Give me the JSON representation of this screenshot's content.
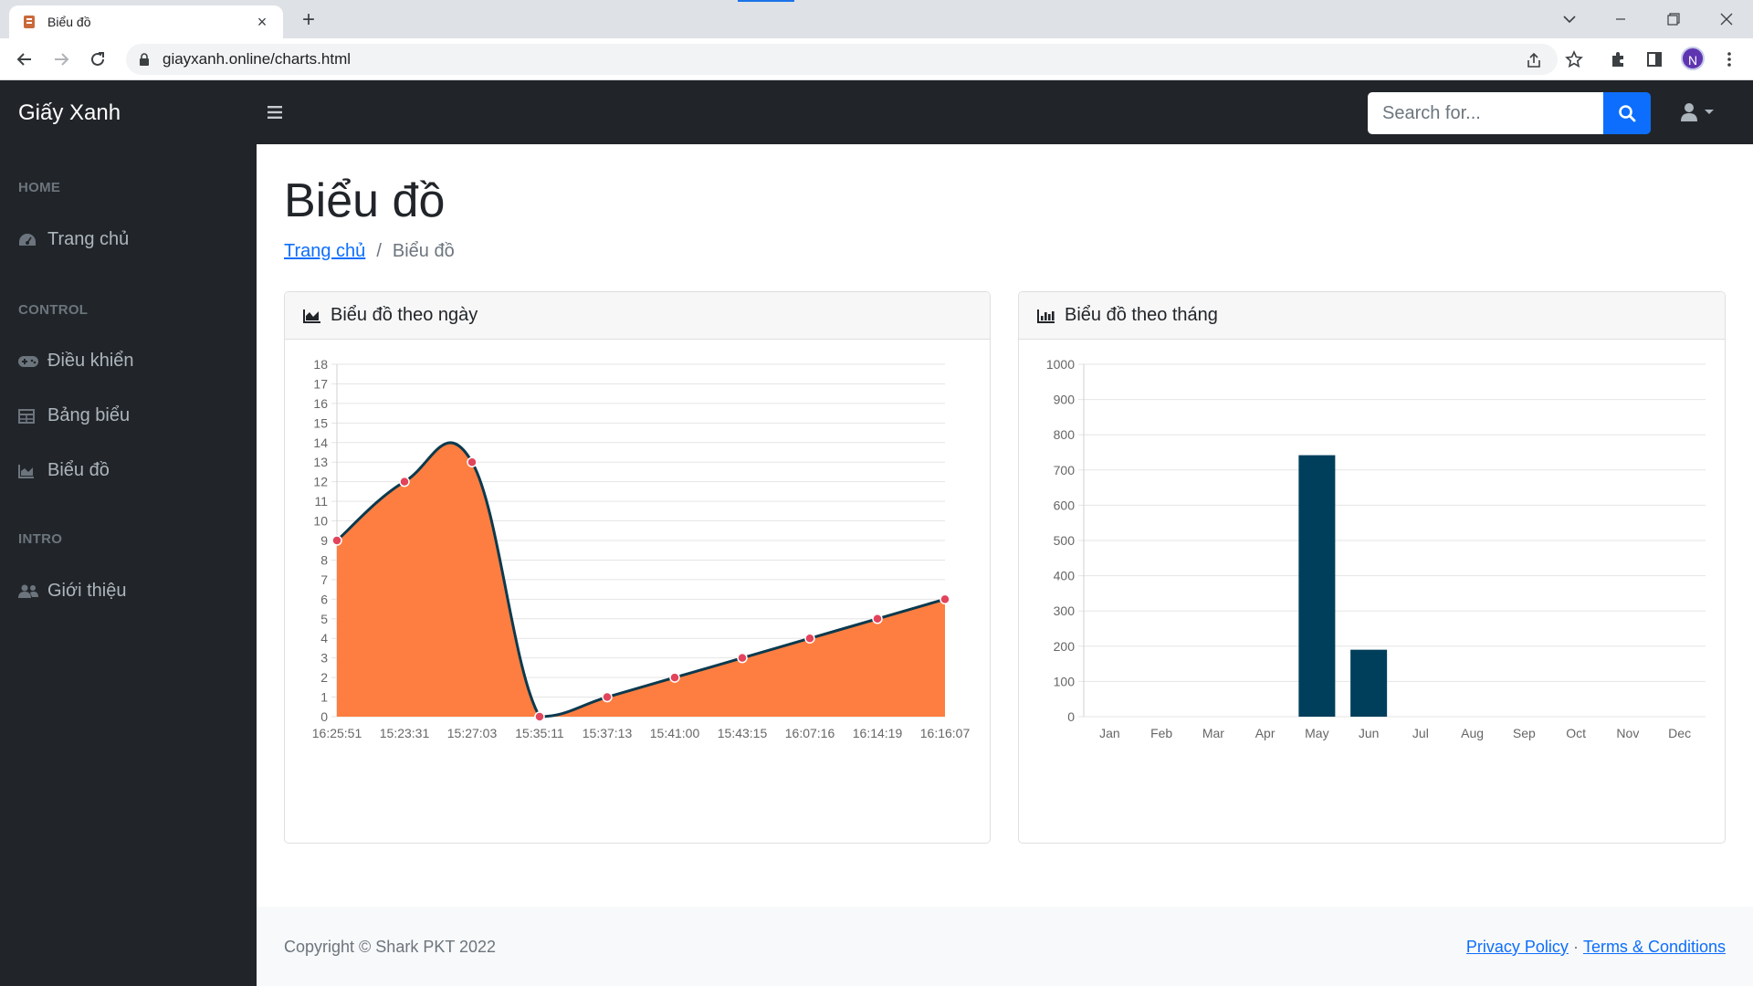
{
  "browser": {
    "tab_title": "Biểu đồ",
    "url": "giayxanh.online/charts.html",
    "profile_initial": "N"
  },
  "app": {
    "brand": "Giấy Xanh",
    "search_placeholder": "Search for..."
  },
  "sidebar": {
    "sections": [
      {
        "heading": "HOME",
        "items": [
          {
            "label": "Trang chủ",
            "icon": "dashboard-icon"
          }
        ]
      },
      {
        "heading": "CONTROL",
        "items": [
          {
            "label": "Điều khiển",
            "icon": "gamepad-icon"
          },
          {
            "label": "Bảng biểu",
            "icon": "table-icon"
          },
          {
            "label": "Biểu đồ",
            "icon": "chart-area-icon"
          }
        ]
      },
      {
        "heading": "INTRO",
        "items": [
          {
            "label": "Giới thiệu",
            "icon": "users-icon"
          }
        ]
      }
    ]
  },
  "page": {
    "title": "Biểu đồ",
    "breadcrumb_home": "Trang chủ",
    "breadcrumb_sep": "/",
    "breadcrumb_current": "Biểu đồ"
  },
  "cards": {
    "area_title": "Biểu đồ theo ngày",
    "bar_title": "Biểu đồ theo tháng"
  },
  "footer": {
    "copyright": "Copyright © Shark PKT 2022",
    "privacy": "Privacy Policy",
    "dot": "·",
    "terms": "Terms & Conditions"
  },
  "colors": {
    "area_fill": "#fd7e40",
    "area_line": "#0b3a4e",
    "point": "#e2445c",
    "bar": "#003f5c",
    "accent": "#0d6efd"
  },
  "chart_data": [
    {
      "type": "area",
      "title": "Biểu đồ theo ngày",
      "categories": [
        "16:25:51",
        "15:23:31",
        "15:27:03",
        "15:35:11",
        "15:37:13",
        "15:41:00",
        "15:43:15",
        "16:07:16",
        "16:14:19",
        "16:16:07"
      ],
      "values": [
        9,
        12,
        13,
        0,
        1,
        2,
        3,
        4,
        5,
        6
      ],
      "ylim": [
        0,
        18
      ],
      "ytick_step": 1,
      "grid": true,
      "legend": "none"
    },
    {
      "type": "bar",
      "title": "Biểu đồ theo tháng",
      "categories": [
        "Jan",
        "Feb",
        "Mar",
        "Apr",
        "May",
        "Jun",
        "Jul",
        "Aug",
        "Sep",
        "Oct",
        "Nov",
        "Dec"
      ],
      "values": [
        0,
        0,
        0,
        0,
        742,
        190,
        0,
        0,
        0,
        0,
        0,
        0
      ],
      "ylim": [
        0,
        1000
      ],
      "ytick_step": 100,
      "grid": true,
      "legend": "none"
    }
  ]
}
